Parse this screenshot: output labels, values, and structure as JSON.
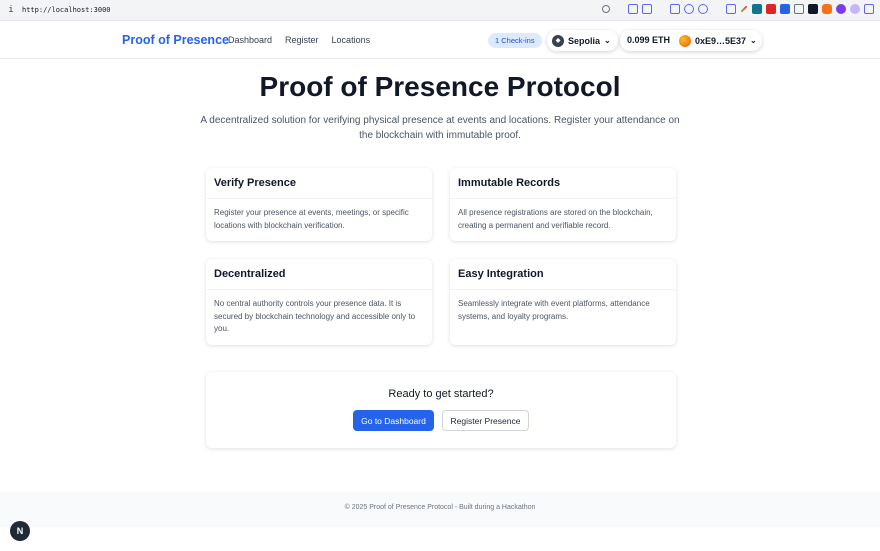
{
  "browser": {
    "info_glyph": "i",
    "url": "http://localhost:3000",
    "extension_icons": [
      {
        "name": "link-icon",
        "color": "#6b7280"
      },
      {
        "name": "extension-icon-1",
        "color": "#6366f1"
      },
      {
        "name": "camera-icon",
        "color": "#6366f1"
      },
      {
        "name": "extension-icon-2",
        "color": "#6366f1"
      },
      {
        "name": "extension-icon-3",
        "color": "#6366f1"
      },
      {
        "name": "extension-icon-4",
        "color": "#6366f1"
      },
      {
        "name": "extension-icon-5",
        "color": "#6366f1"
      },
      {
        "name": "pen-icon",
        "color": "#84cc16"
      },
      {
        "name": "extension-icon-6",
        "color": "#0e7490"
      },
      {
        "name": "extension-icon-7",
        "color": "#dc2626"
      },
      {
        "name": "extension-icon-8",
        "color": "#2563eb"
      },
      {
        "name": "extension-icon-9",
        "color": "#6b7280"
      },
      {
        "name": "m-icon",
        "color": "#111827"
      },
      {
        "name": "metamask-fox-icon",
        "color": "#f97316"
      },
      {
        "name": "extension-icon-10",
        "color": "#7c3aed"
      },
      {
        "name": "extension-icon-11",
        "color": "#a78bfa"
      },
      {
        "name": "sidebar-icon",
        "color": "#6366f1"
      }
    ]
  },
  "header": {
    "brand": "Proof of Presence",
    "nav": [
      "Dashboard",
      "Register",
      "Locations"
    ],
    "checkins": "1 Check-ins",
    "network": "Sepolia",
    "balance": "0.099 ETH",
    "account": "0xE9…5E37"
  },
  "hero": {
    "title": "Proof of Presence Protocol",
    "subtitle": "A decentralized solution for verifying physical presence at events and locations. Register your attendance on the blockchain with immutable proof."
  },
  "features": [
    {
      "title": "Verify Presence",
      "body": "Register your presence at events, meetings, or specific locations with blockchain verification."
    },
    {
      "title": "Immutable Records",
      "body": "All presence registrations are stored on the blockchain, creating a permanent and verifiable record."
    },
    {
      "title": "Decentralized",
      "body": "No central authority controls your presence data. It is secured by blockchain technology and accessible only to you."
    },
    {
      "title": "Easy Integration",
      "body": "Seamlessly integrate with event platforms, attendance systems, and loyalty programs."
    }
  ],
  "cta": {
    "title": "Ready to get started?",
    "primary": "Go to Dashboard",
    "secondary": "Register Presence"
  },
  "footer": {
    "text": "© 2025 Proof of Presence Protocol - Built during a Hackathon"
  },
  "dev_badge": "N",
  "colors": {
    "accent": "#2563eb",
    "badge_bg": "#dbeafe",
    "badge_text": "#1d4ed8"
  }
}
